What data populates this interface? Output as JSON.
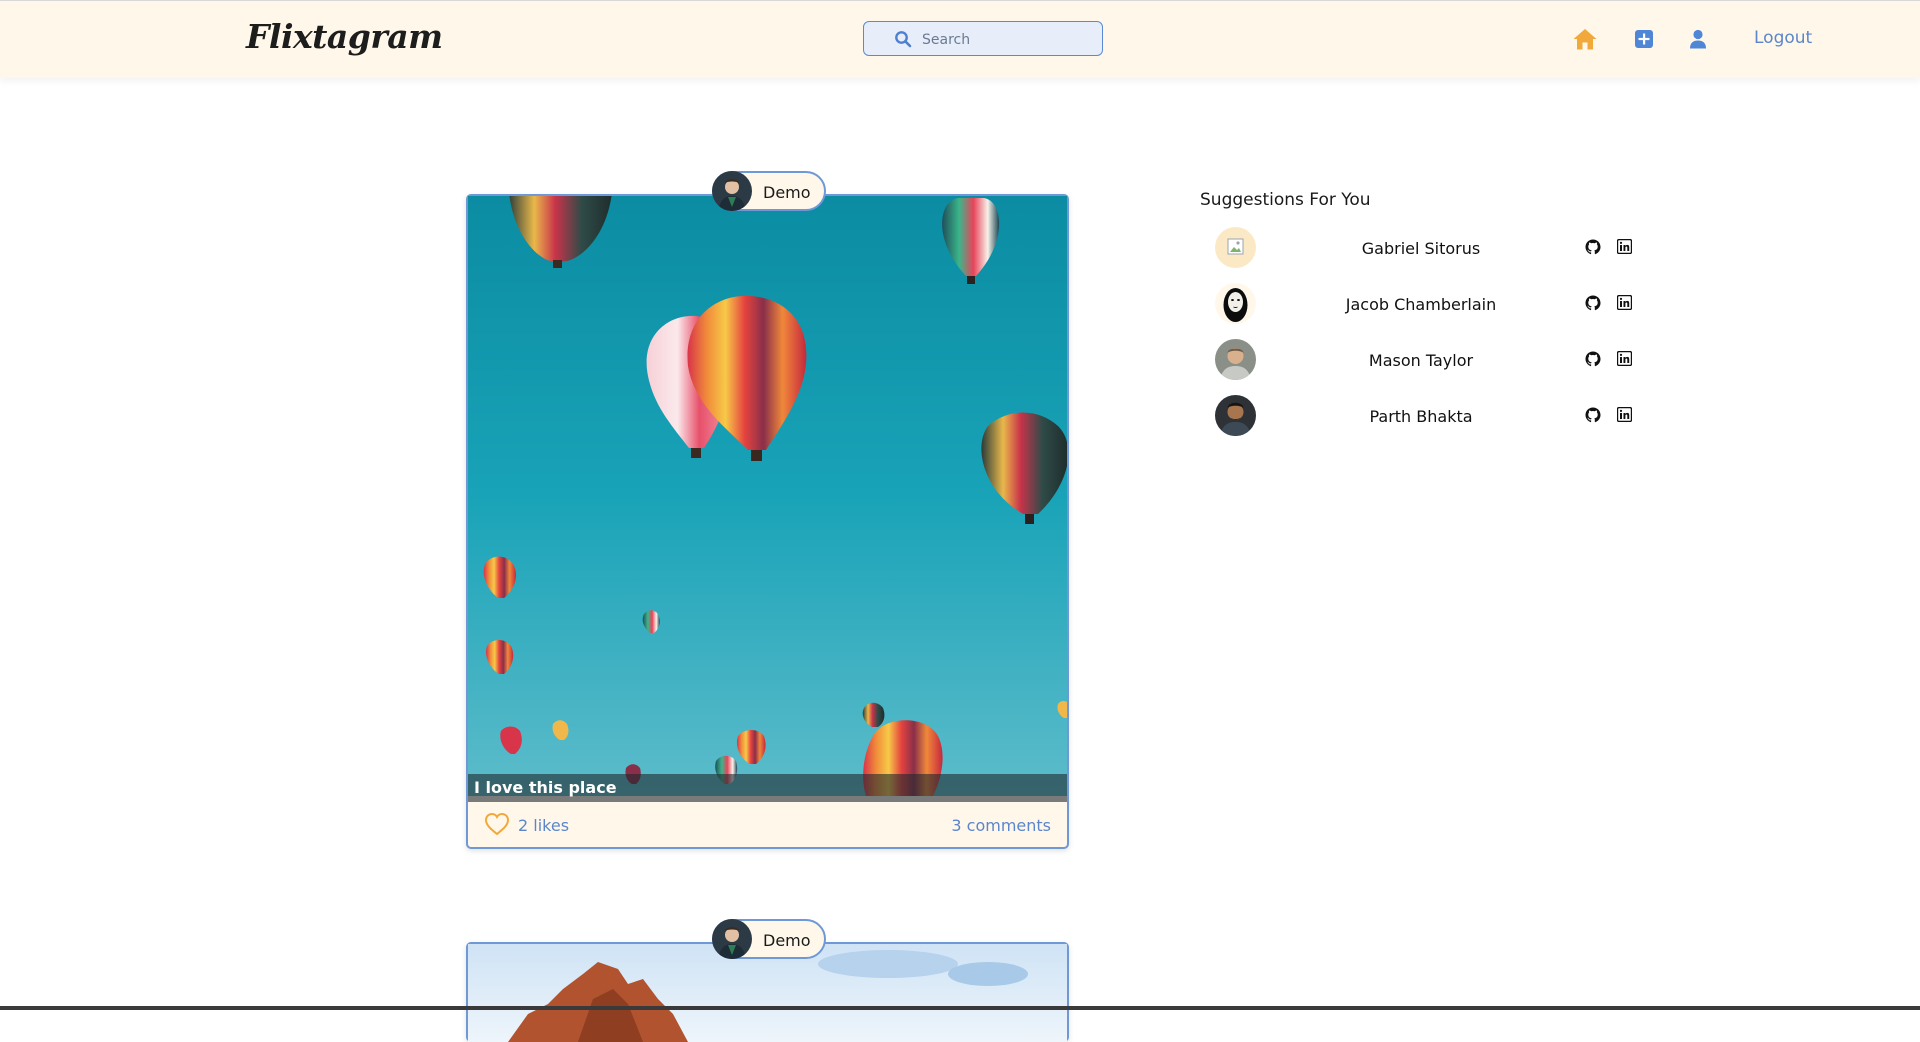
{
  "app": {
    "name": "Flixtagram"
  },
  "nav": {
    "search_placeholder": "Search",
    "icons": [
      "home-icon",
      "add-post-icon",
      "profile-icon"
    ],
    "logout_label": "Logout",
    "accent_color": "#f2a93b",
    "link_color": "#5b86cc"
  },
  "posts": [
    {
      "user": "Demo",
      "caption": "I love this place",
      "likes": "2 likes",
      "comments": "3 comments"
    },
    {
      "user": "Demo"
    }
  ],
  "suggestions": {
    "title": "Suggestions For You",
    "users": [
      {
        "name": "Gabriel Sitorus",
        "links": [
          "github-icon",
          "linkedin-icon"
        ]
      },
      {
        "name": "Jacob Chamberlain",
        "links": [
          "github-icon",
          "linkedin-icon"
        ]
      },
      {
        "name": "Mason Taylor",
        "links": [
          "github-icon",
          "linkedin-icon"
        ]
      },
      {
        "name": "Parth Bhakta",
        "links": [
          "github-icon",
          "linkedin-icon"
        ]
      }
    ]
  }
}
